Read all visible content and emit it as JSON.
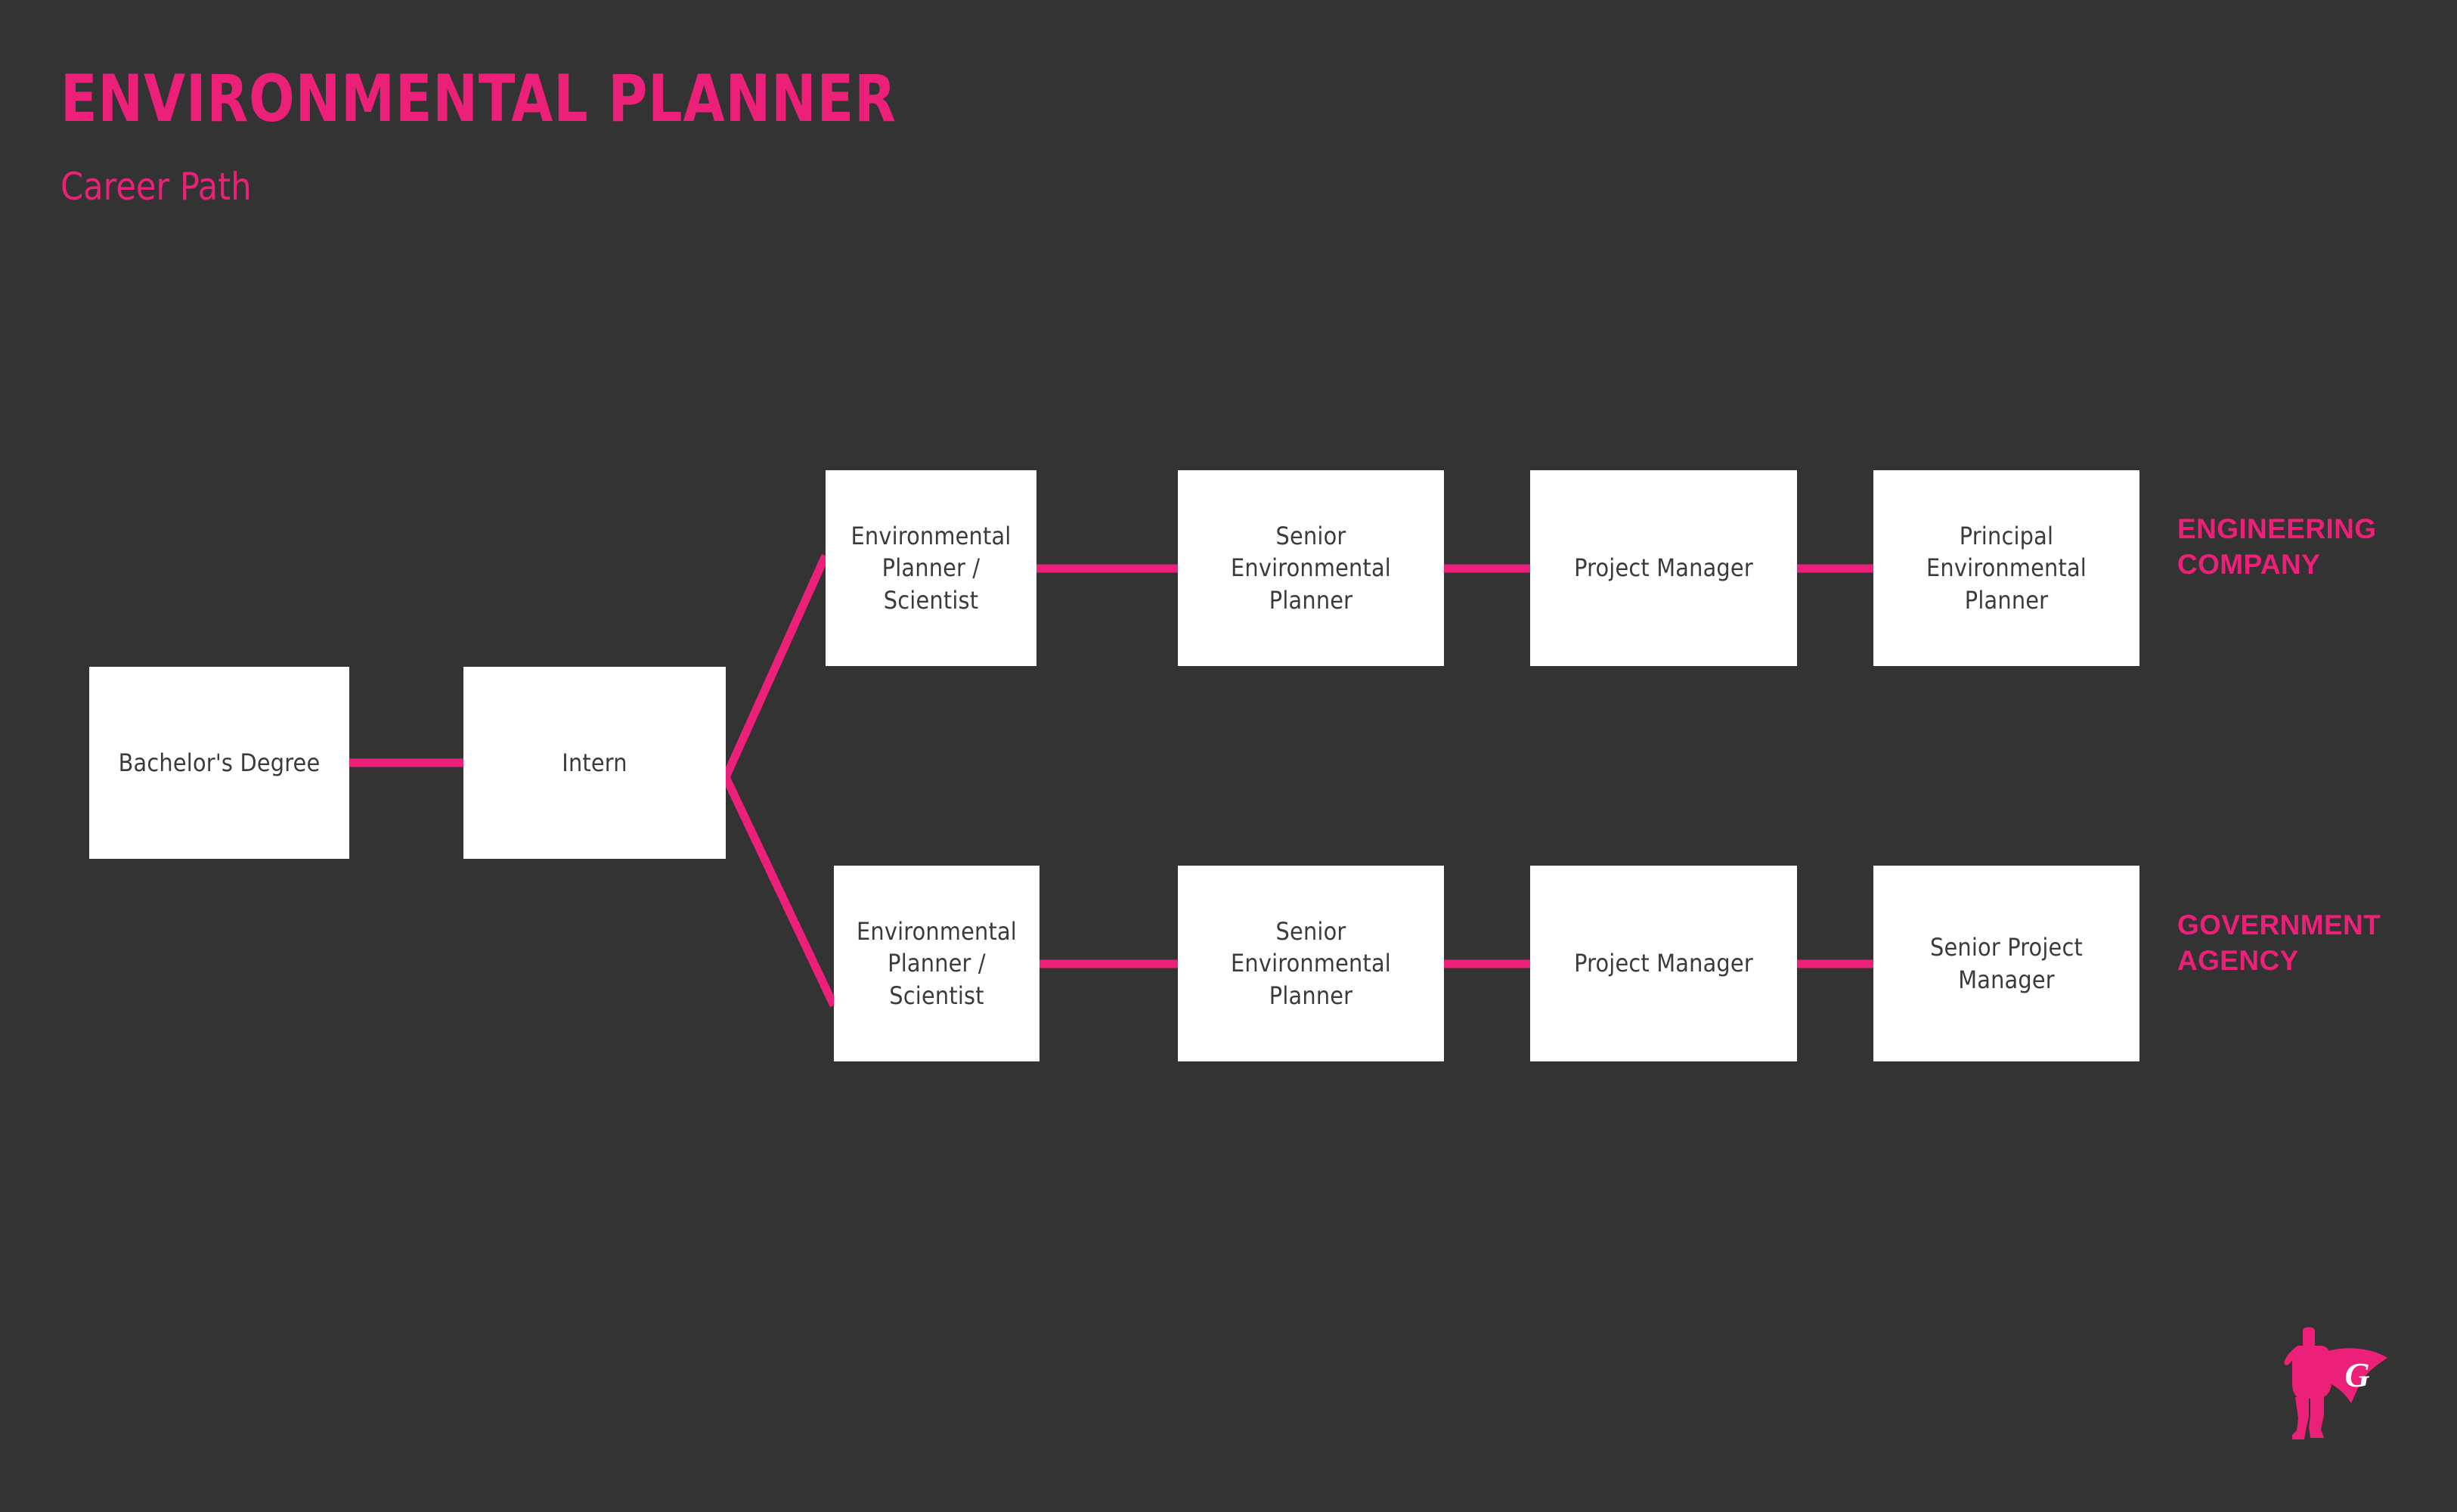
{
  "page": {
    "background_color": "#333333",
    "accent_color": "#EC2078",
    "node_fill_color": "#FFFFFF",
    "node_text_color": "#3B3B3B"
  },
  "header": {
    "title": "ENVIRONMENTAL PLANNER",
    "subtitle": "Career Path"
  },
  "diagram": {
    "type": "career-path-flowchart",
    "shared_stages": [
      {
        "id": "bachelors-degree",
        "label": "Bachelor's Degree"
      },
      {
        "id": "intern",
        "label": "Intern"
      }
    ],
    "tracks": [
      {
        "id": "engineering-company",
        "label": "ENGINEERING\nCOMPANY",
        "stages": [
          {
            "id": "env-planner-scientist",
            "label": "Environmental\nPlanner / Scientist"
          },
          {
            "id": "senior-env-planner",
            "label": "Senior\nEnvironmental\nPlanner"
          },
          {
            "id": "project-manager",
            "label": "Project Manager"
          },
          {
            "id": "principal-env-planner",
            "label": "Principal\nEnvironmental\nPlanner"
          }
        ]
      },
      {
        "id": "government-agency",
        "label": "GOVERNMENT\nAGENCY",
        "stages": [
          {
            "id": "env-planner-scientist",
            "label": "Environmental\nPlanner / Scientist"
          },
          {
            "id": "senior-env-planner",
            "label": "Senior\nEnvironmental\nPlanner"
          },
          {
            "id": "project-manager",
            "label": "Project Manager"
          },
          {
            "id": "senior-project-manager",
            "label": "Senior Project\nManager"
          }
        ]
      }
    ]
  },
  "logo": {
    "name": "superhero-g-logo",
    "letter": "G"
  }
}
